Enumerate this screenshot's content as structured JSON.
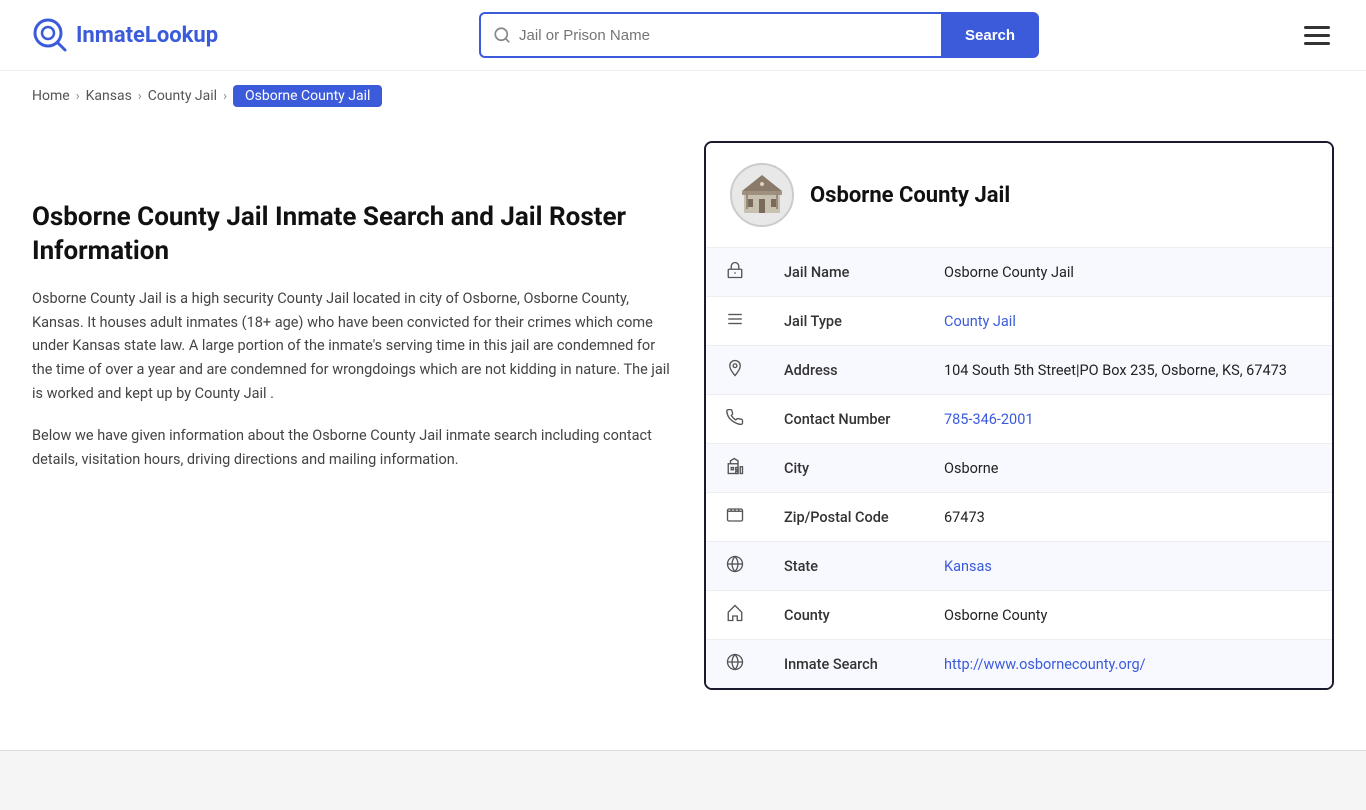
{
  "header": {
    "logo_brand": "InmateLookup",
    "logo_brand_prefix": "Inmate",
    "logo_brand_suffix": "Lookup",
    "search_placeholder": "Jail or Prison Name",
    "search_button_label": "Search"
  },
  "breadcrumb": {
    "home": "Home",
    "state": "Kansas",
    "type": "County Jail",
    "current": "Osborne County Jail"
  },
  "left": {
    "title": "Osborne County Jail Inmate Search and Jail Roster Information",
    "description1": "Osborne County Jail is a high security County Jail located in city of Osborne, Osborne County, Kansas. It houses adult inmates (18+ age) who have been convicted for their crimes which come under Kansas state law. A large portion of the inmate's serving time in this jail are condemned for the time of over a year and are condemned for wrongdoings which are not kidding in nature. The jail is worked and kept up by County Jail .",
    "description2": "Below we have given information about the Osborne County Jail inmate search including contact details, visitation hours, driving directions and mailing information."
  },
  "card": {
    "name": "Osborne County Jail",
    "fields": [
      {
        "icon": "jail-icon",
        "label": "Jail Name",
        "value": "Osborne County Jail",
        "link": null
      },
      {
        "icon": "list-icon",
        "label": "Jail Type",
        "value": "County Jail",
        "link": "#"
      },
      {
        "icon": "location-icon",
        "label": "Address",
        "value": "104 South 5th Street|PO Box 235, Osborne, KS, 67473",
        "link": null
      },
      {
        "icon": "phone-icon",
        "label": "Contact Number",
        "value": "785-346-2001",
        "link": "tel:785-346-2001"
      },
      {
        "icon": "city-icon",
        "label": "City",
        "value": "Osborne",
        "link": null
      },
      {
        "icon": "zip-icon",
        "label": "Zip/Postal Code",
        "value": "67473",
        "link": null
      },
      {
        "icon": "globe-icon",
        "label": "State",
        "value": "Kansas",
        "link": "#"
      },
      {
        "icon": "county-icon",
        "label": "County",
        "value": "Osborne County",
        "link": null
      },
      {
        "icon": "search-globe-icon",
        "label": "Inmate Search",
        "value": "http://www.osbornecounty.org/",
        "link": "http://www.osbornecounty.org/"
      }
    ]
  }
}
